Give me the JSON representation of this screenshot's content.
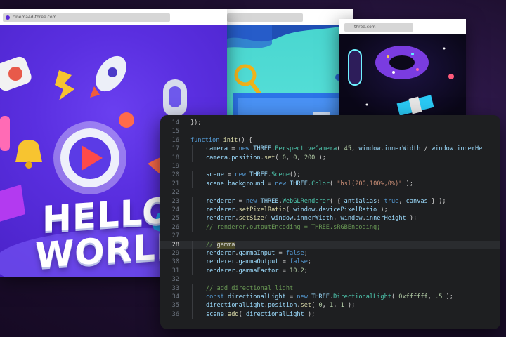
{
  "window1": {
    "url": "cinema4d-three.com",
    "headline_line1": "HELLO",
    "headline_line2": "WORLD!"
  },
  "window2": {
    "url": ""
  },
  "window3": {
    "url": "three.com"
  },
  "editor": {
    "lines": [
      {
        "num": "14",
        "tokens": [
          [
            "p",
            "});"
          ]
        ]
      },
      {
        "num": "15",
        "tokens": []
      },
      {
        "num": "16",
        "tokens": [
          [
            "kw",
            "function "
          ],
          [
            "fn",
            "init"
          ],
          [
            "p",
            "() {"
          ]
        ]
      },
      {
        "num": "17",
        "indent": 1,
        "tokens": [
          [
            "var",
            "camera"
          ],
          [
            "p",
            " = "
          ],
          [
            "kw",
            "new "
          ],
          [
            "var",
            "THREE"
          ],
          [
            "p",
            "."
          ],
          [
            "cls",
            "PerspectiveCamera"
          ],
          [
            "p",
            "( "
          ],
          [
            "num",
            "45"
          ],
          [
            "p",
            ", "
          ],
          [
            "var",
            "window"
          ],
          [
            "p",
            "."
          ],
          [
            "var",
            "innerWidth"
          ],
          [
            "p",
            " / "
          ],
          [
            "var",
            "window"
          ],
          [
            "p",
            "."
          ],
          [
            "var",
            "innerHe"
          ]
        ]
      },
      {
        "num": "18",
        "indent": 1,
        "tokens": [
          [
            "var",
            "camera"
          ],
          [
            "p",
            "."
          ],
          [
            "var",
            "position"
          ],
          [
            "p",
            "."
          ],
          [
            "fn",
            "set"
          ],
          [
            "p",
            "( "
          ],
          [
            "num",
            "0"
          ],
          [
            "p",
            ", "
          ],
          [
            "num",
            "0"
          ],
          [
            "p",
            ", "
          ],
          [
            "num",
            "200"
          ],
          [
            "p",
            " );"
          ]
        ]
      },
      {
        "num": "19",
        "tokens": []
      },
      {
        "num": "20",
        "indent": 1,
        "tokens": [
          [
            "var",
            "scene"
          ],
          [
            "p",
            " = "
          ],
          [
            "kw",
            "new "
          ],
          [
            "var",
            "THREE"
          ],
          [
            "p",
            "."
          ],
          [
            "cls",
            "Scene"
          ],
          [
            "p",
            "();"
          ]
        ]
      },
      {
        "num": "21",
        "indent": 1,
        "tokens": [
          [
            "var",
            "scene"
          ],
          [
            "p",
            "."
          ],
          [
            "var",
            "background"
          ],
          [
            "p",
            " = "
          ],
          [
            "kw",
            "new "
          ],
          [
            "var",
            "THREE"
          ],
          [
            "p",
            "."
          ],
          [
            "cls",
            "Color"
          ],
          [
            "p",
            "( "
          ],
          [
            "str",
            "\"hsl(200,100%,0%)\""
          ],
          [
            "p",
            " );"
          ]
        ]
      },
      {
        "num": "22",
        "tokens": []
      },
      {
        "num": "23",
        "indent": 1,
        "tokens": [
          [
            "var",
            "renderer"
          ],
          [
            "p",
            " = "
          ],
          [
            "kw",
            "new "
          ],
          [
            "var",
            "THREE"
          ],
          [
            "p",
            "."
          ],
          [
            "cls",
            "WebGLRenderer"
          ],
          [
            "p",
            "( { "
          ],
          [
            "var",
            "antialias"
          ],
          [
            "p",
            ": "
          ],
          [
            "kw",
            "true"
          ],
          [
            "p",
            ", "
          ],
          [
            "var",
            "canvas"
          ],
          [
            "p",
            " } );"
          ]
        ]
      },
      {
        "num": "24",
        "indent": 1,
        "tokens": [
          [
            "var",
            "renderer"
          ],
          [
            "p",
            "."
          ],
          [
            "fn",
            "setPixelRatio"
          ],
          [
            "p",
            "( "
          ],
          [
            "var",
            "window"
          ],
          [
            "p",
            "."
          ],
          [
            "var",
            "devicePixelRatio"
          ],
          [
            "p",
            " );"
          ]
        ]
      },
      {
        "num": "25",
        "indent": 1,
        "tokens": [
          [
            "var",
            "renderer"
          ],
          [
            "p",
            "."
          ],
          [
            "fn",
            "setSize"
          ],
          [
            "p",
            "( "
          ],
          [
            "var",
            "window"
          ],
          [
            "p",
            "."
          ],
          [
            "var",
            "innerWidth"
          ],
          [
            "p",
            ", "
          ],
          [
            "var",
            "window"
          ],
          [
            "p",
            "."
          ],
          [
            "var",
            "innerHeight"
          ],
          [
            "p",
            " );"
          ]
        ]
      },
      {
        "num": "26",
        "indent": 1,
        "tokens": [
          [
            "cmt",
            "// renderer.outputEncoding = THREE.sRGBEncoding;"
          ]
        ]
      },
      {
        "num": "27",
        "tokens": []
      },
      {
        "num": "28",
        "indent": 1,
        "active": true,
        "tokens": [
          [
            "cmt",
            "// "
          ],
          [
            "hl",
            "gamma"
          ]
        ]
      },
      {
        "num": "29",
        "indent": 1,
        "tokens": [
          [
            "var",
            "renderer"
          ],
          [
            "p",
            "."
          ],
          [
            "var",
            "gammaInput"
          ],
          [
            "p",
            " = "
          ],
          [
            "kw",
            "false"
          ],
          [
            "p",
            ";"
          ]
        ]
      },
      {
        "num": "30",
        "indent": 1,
        "tokens": [
          [
            "var",
            "renderer"
          ],
          [
            "p",
            "."
          ],
          [
            "var",
            "gammaOutput"
          ],
          [
            "p",
            " = "
          ],
          [
            "kw",
            "false"
          ],
          [
            "p",
            ";"
          ]
        ]
      },
      {
        "num": "31",
        "indent": 1,
        "tokens": [
          [
            "var",
            "renderer"
          ],
          [
            "p",
            "."
          ],
          [
            "var",
            "gammaFactor"
          ],
          [
            "p",
            " = "
          ],
          [
            "num",
            "10.2"
          ],
          [
            "p",
            ";"
          ]
        ]
      },
      {
        "num": "32",
        "tokens": []
      },
      {
        "num": "33",
        "indent": 1,
        "tokens": [
          [
            "cmt",
            "// add directional light"
          ]
        ]
      },
      {
        "num": "34",
        "indent": 1,
        "tokens": [
          [
            "kw",
            "const "
          ],
          [
            "var",
            "directionalLight"
          ],
          [
            "p",
            " = "
          ],
          [
            "kw",
            "new "
          ],
          [
            "var",
            "THREE"
          ],
          [
            "p",
            "."
          ],
          [
            "cls",
            "DirectionalLight"
          ],
          [
            "p",
            "( "
          ],
          [
            "num",
            "0xffffff"
          ],
          [
            "p",
            ", "
          ],
          [
            "num",
            ".5"
          ],
          [
            "p",
            " );"
          ]
        ]
      },
      {
        "num": "35",
        "indent": 1,
        "tokens": [
          [
            "var",
            "directionalLight"
          ],
          [
            "p",
            "."
          ],
          [
            "var",
            "position"
          ],
          [
            "p",
            "."
          ],
          [
            "fn",
            "set"
          ],
          [
            "p",
            "( "
          ],
          [
            "num",
            "0"
          ],
          [
            "p",
            ", "
          ],
          [
            "num",
            "1"
          ],
          [
            "p",
            ", "
          ],
          [
            "num",
            "1"
          ],
          [
            "p",
            " );"
          ]
        ]
      },
      {
        "num": "36",
        "indent": 1,
        "tokens": [
          [
            "var",
            "scene"
          ],
          [
            "p",
            "."
          ],
          [
            "fn",
            "add"
          ],
          [
            "p",
            "( "
          ],
          [
            "var",
            "directionalLight"
          ],
          [
            "p",
            " );"
          ]
        ]
      }
    ]
  }
}
